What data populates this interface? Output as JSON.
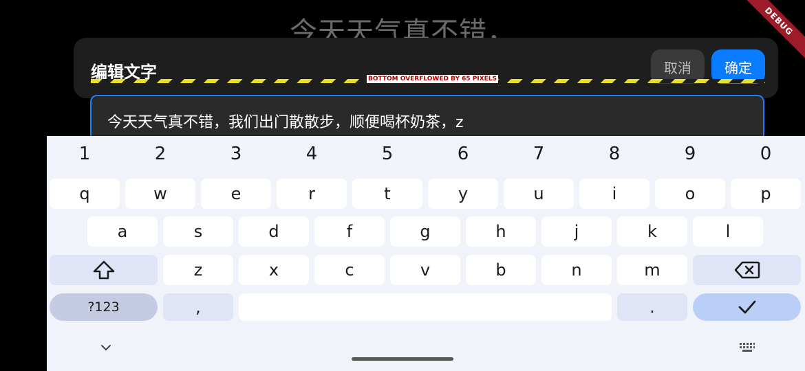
{
  "background_title": "今天天气真不错，",
  "dialog": {
    "title": "编辑文字",
    "cancel_label": "取消",
    "confirm_label": "确定",
    "overflow_warning": "BOTTOM OVERFLOWED BY 65 PIXELS"
  },
  "debug_banner": "DEBUG",
  "text_field": {
    "value": "今天天气真不错，我们出门散散步，顺便喝杯奶茶，z"
  },
  "keyboard": {
    "number_row": [
      "1",
      "2",
      "3",
      "4",
      "5",
      "6",
      "7",
      "8",
      "9",
      "0"
    ],
    "row1": [
      "q",
      "w",
      "e",
      "r",
      "t",
      "y",
      "u",
      "i",
      "o",
      "p"
    ],
    "row2": [
      "a",
      "s",
      "d",
      "f",
      "g",
      "h",
      "j",
      "k",
      "l"
    ],
    "row3": [
      "z",
      "x",
      "c",
      "v",
      "b",
      "n",
      "m"
    ],
    "symbols_label": "?123",
    "comma_label": ",",
    "period_label": ".",
    "shift_icon": "shift-icon",
    "backspace_icon": "backspace-icon",
    "enter_icon": "checkmark-icon",
    "hide_icon": "chevron-down-icon",
    "switch_icon": "keyboard-icon"
  },
  "colors": {
    "accent": "#0a7cff",
    "keyboard_bg": "#f1f3fb",
    "special_key": "#dfe4f7",
    "debug_banner": "#9e1b2a"
  }
}
